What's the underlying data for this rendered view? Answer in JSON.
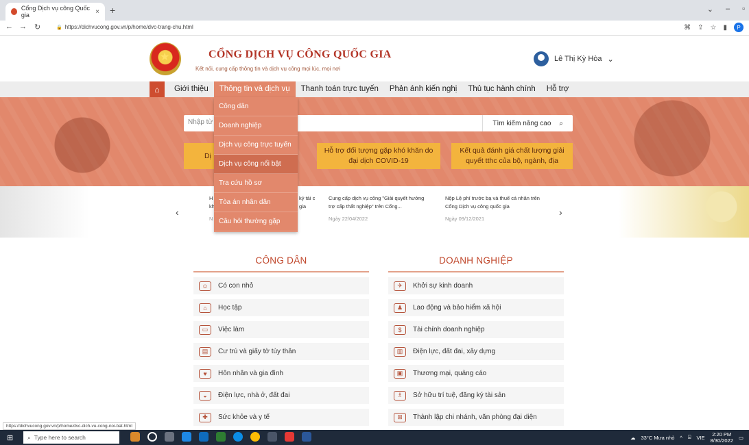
{
  "browser": {
    "tab_title": "Cổng Dịch vụ công Quốc gia",
    "tab_close": "×",
    "new_tab": "+",
    "url": "https://dichvucong.gov.vn/p/home/dvc-trang-chu.html",
    "profile_initial": "P"
  },
  "header": {
    "title": "CỔNG DỊCH VỤ CÔNG QUỐC GIA",
    "subtitle": "Kết nối, cung cấp thông tin và dịch vụ công mọi lúc, mọi nơi",
    "user_name": "Lê Thị Kỳ Hòa"
  },
  "nav": {
    "home_icon": "home-icon",
    "items": [
      "Giới thiệu",
      "Thông tin và dịch vụ",
      "Thanh toán trực tuyến",
      "Phản ánh kiến nghị",
      "Thủ tục hành chính",
      "Hỗ trợ"
    ]
  },
  "dropdown": {
    "items": [
      "Công dân",
      "Doanh nghiệp",
      "Dịch vụ công trực tuyến",
      "Dịch vụ công nổi bật",
      "Tra cứu hồ sơ",
      "Tòa án nhân dân",
      "Câu hỏi thường gặp"
    ]
  },
  "search": {
    "placeholder": "Nhập từ",
    "advanced": "Tìm kiếm nâng cao"
  },
  "hero_buttons": {
    "b1_prefix": "Dị",
    "b2": "Hỗ trợ đối tượng gặp khó khăn do đại dịch COVID-19",
    "b3": "Kết quả đánh giá chất lượng giải quyết tthc của bộ, ngành, địa"
  },
  "news": {
    "partial_title": "H kh",
    "partial_date": "N",
    "partial_right": "ký tài c gia",
    "item2_title": "Cung cấp dịch vụ công \"Giải quyết hưởng trợ cấp thất nghiệp\" trên Cổng...",
    "item2_date": "Ngày 22/04/2022",
    "item3_title": "Nộp Lệ phí trước bạ và thuế cá nhân trên Cổng Dịch vụ công quốc gia",
    "item3_date": "Ngày 09/12/2021"
  },
  "cong_dan": {
    "title": "CÔNG DÂN",
    "items": [
      "Có con nhỏ",
      "Học tập",
      "Việc làm",
      "Cư trú và giấy tờ tùy thân",
      "Hôn nhân và gia đình",
      "Điện lực, nhà ở, đất đai",
      "Sức khỏe và y tế"
    ]
  },
  "doanh_nghiep": {
    "title": "DOANH NGHIỆP",
    "items": [
      "Khởi sự kinh doanh",
      "Lao động và bảo hiểm xã hội",
      "Tài chính doanh nghiệp",
      "Điện lực, đất đai, xây dựng",
      "Thương mại, quảng cáo",
      "Sở hữu trí tuệ, đăng ký tài sản",
      "Thành lập chi nhánh, văn phòng đại diện"
    ]
  },
  "status_url": "https://dichvucong.gov.vn/p/home/dvc-dich-vu-cong-noi-bat.html",
  "taskbar": {
    "search_placeholder": "Type here to search",
    "weather": "33°C Mưa nhỏ",
    "lang": "VIE",
    "time": "2:20 PM",
    "date": "8/30/2022"
  }
}
